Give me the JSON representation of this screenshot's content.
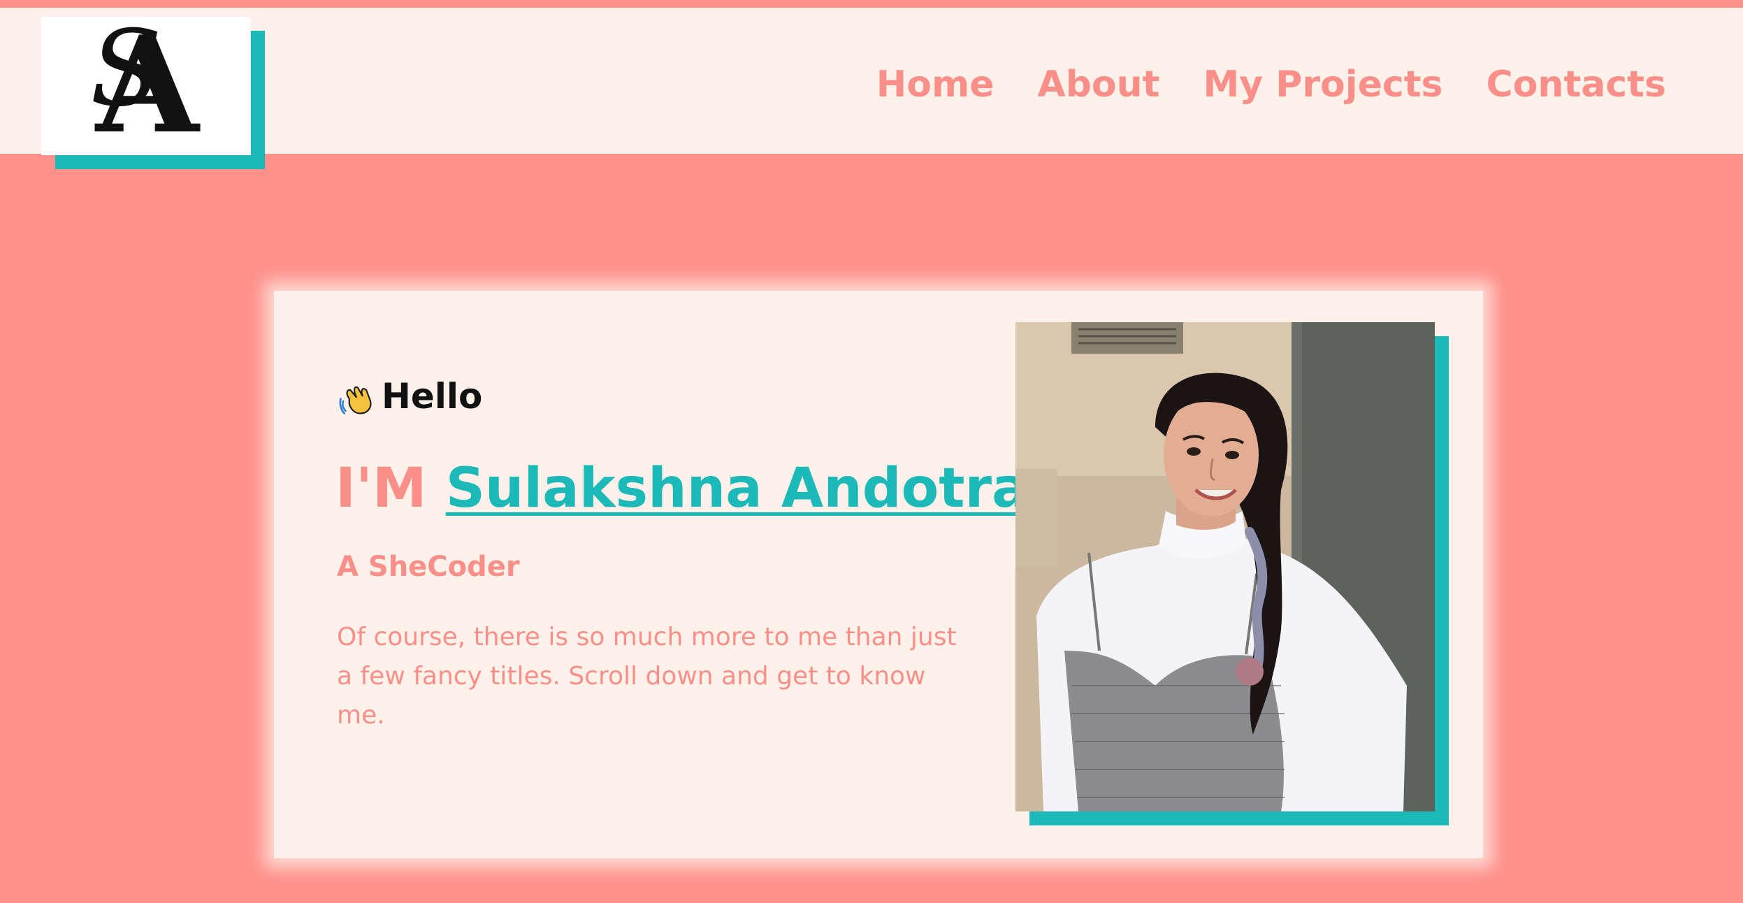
{
  "logo": {
    "text": "SA",
    "icon": "sa-monogram-logo"
  },
  "nav": {
    "items": [
      {
        "label": "Home"
      },
      {
        "label": "About"
      },
      {
        "label": "My Projects"
      },
      {
        "label": "Contacts"
      }
    ]
  },
  "hero": {
    "greeting_icon": "waving-hand-icon",
    "greeting": "Hello",
    "title_prefix": "I'M",
    "name": "Sulakshna Andotra",
    "subtitle": "A SheCoder",
    "description": "Of course, there is so much more to me than just a few fancy titles. Scroll down and get to know me.",
    "photo": "profile-photo"
  },
  "colors": {
    "background": "#ff908a",
    "cream": "#fdf1e9",
    "accent": "#1cb9b8",
    "coral_text": "#fa8f8a"
  }
}
